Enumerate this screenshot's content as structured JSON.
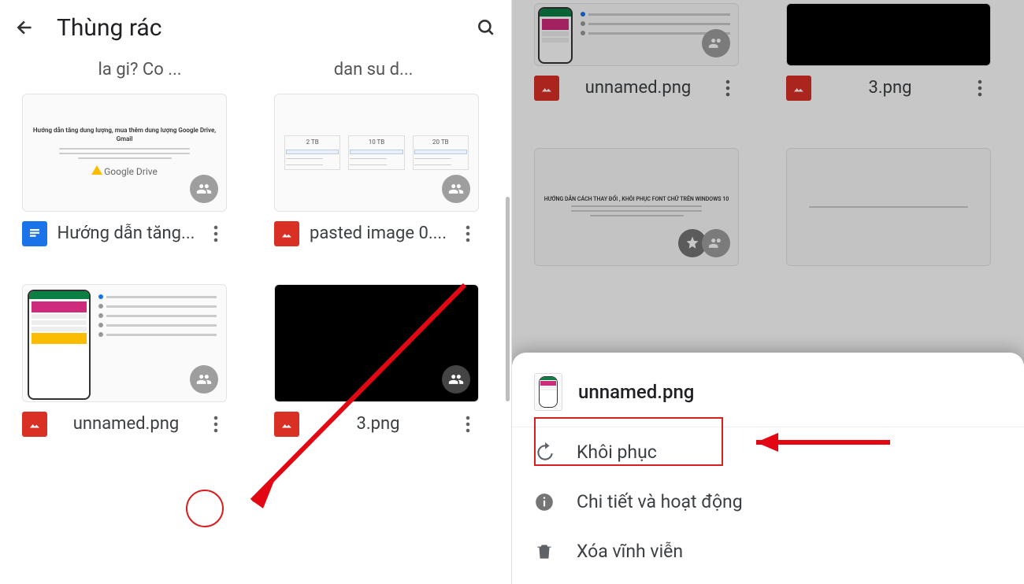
{
  "left": {
    "title": "Thùng rác",
    "truncated1": "la gi? Co ...",
    "truncated2": "dan su d...",
    "storage_plans": [
      "2 TB",
      "10 TB",
      "20 TB"
    ],
    "thumb_drive_label": "Google Drive",
    "cards": [
      {
        "name": "Hướng dẫn tăng...",
        "type": "doc"
      },
      {
        "name": "pasted image 0....",
        "type": "img"
      },
      {
        "name": "unnamed.png",
        "type": "img"
      },
      {
        "name": "3.png",
        "type": "img"
      }
    ]
  },
  "right": {
    "cards_top": [
      {
        "name": "unnamed.png",
        "type": "img"
      },
      {
        "name": "3.png",
        "type": "img"
      }
    ],
    "sheet": {
      "filename": "unnamed.png",
      "restore": "Khôi phục",
      "details": "Chi tiết và hoạt động",
      "delete": "Xóa vĩnh viễn"
    }
  }
}
